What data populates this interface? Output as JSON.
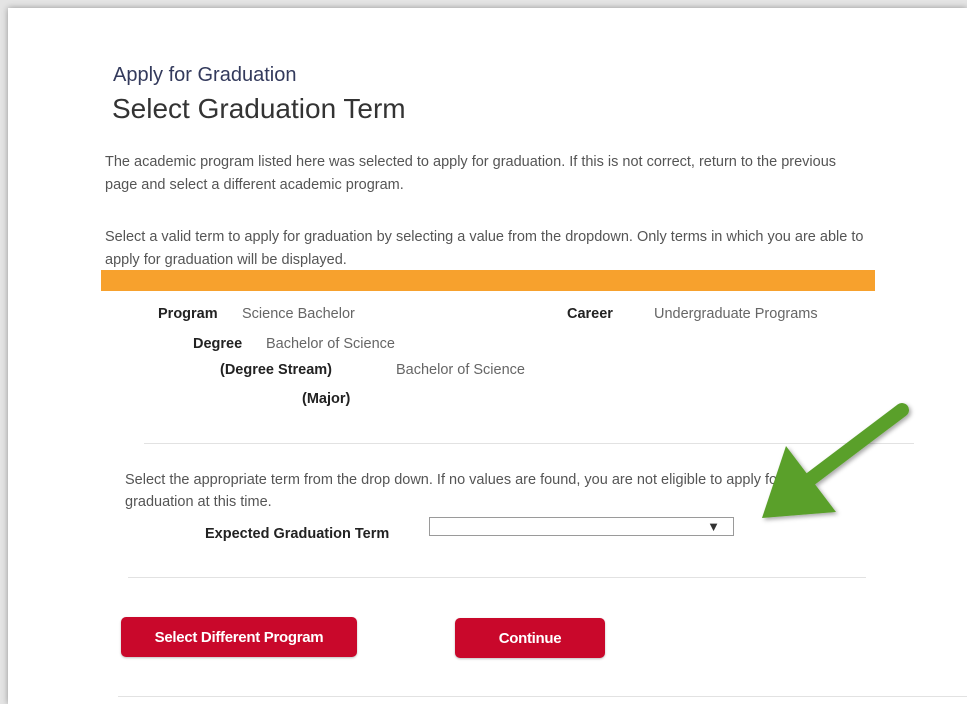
{
  "header": {
    "breadcrumb": "Apply for Graduation",
    "title": "Select Graduation Term"
  },
  "intro": {
    "paragraph1": "The academic program listed here was selected to apply for graduation. If this is not correct, return to the previous page and select a different academic program.",
    "paragraph2": "Select a valid term to apply for graduation by selecting a value from the dropdown. Only terms in which you are able to apply for graduation will be displayed."
  },
  "program": {
    "program_label": "Program",
    "program_value": "Science Bachelor",
    "career_label": "Career",
    "career_value": "Undergraduate Programs",
    "degree_label": "Degree",
    "degree_value": "Bachelor of Science",
    "stream_label": "(Degree Stream)",
    "stream_value": "Bachelor of Science",
    "major_label": "(Major)"
  },
  "term": {
    "note": "Select the appropriate term from the drop down. If no values are found, you are not eligible to apply for graduation at this time.",
    "label": "Expected Graduation Term",
    "selected_value": ""
  },
  "buttons": {
    "select_different": "Select Different Program",
    "continue": "Continue"
  },
  "colors": {
    "accent_bar": "#f7a12d",
    "button": "#c9082b",
    "annotation_arrow": "#5aa02c"
  },
  "icons": {
    "dropdown": "triangle-down-icon",
    "annotation": "arrow-icon"
  }
}
